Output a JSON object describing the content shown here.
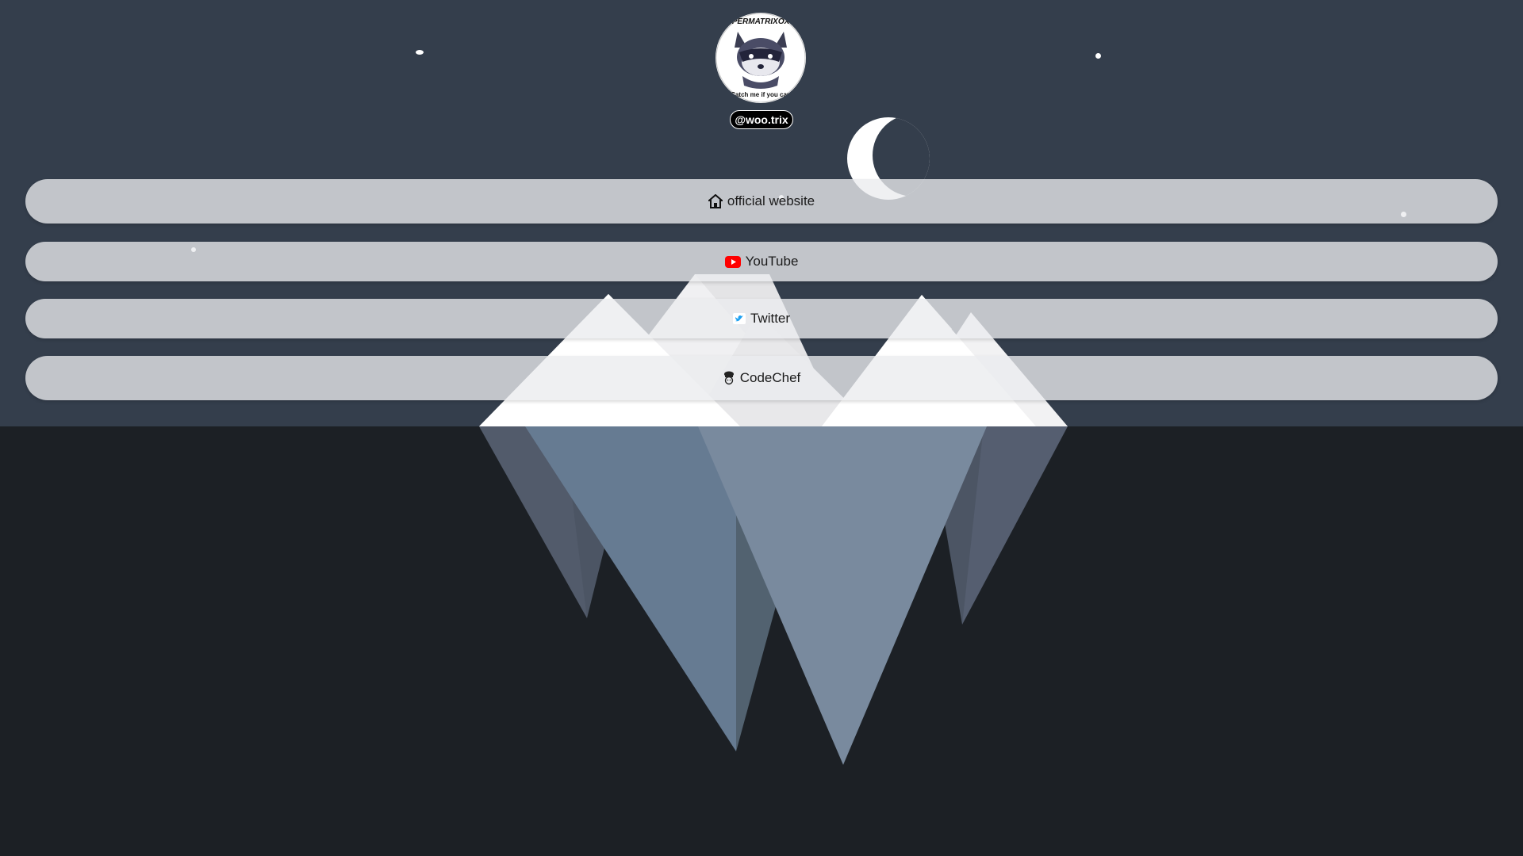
{
  "profile": {
    "avatar_top_text": "PERMATRIXOX",
    "avatar_bottom_text": "Catch me if you can",
    "handle": "@woo.trix"
  },
  "links": [
    {
      "label": "official website",
      "icon": "home-icon"
    },
    {
      "label": "YouTube",
      "icon": "youtube-icon"
    },
    {
      "label": "Twitter",
      "icon": "twitter-icon"
    },
    {
      "label": "CodeChef",
      "icon": "codechef-chef-icon"
    }
  ],
  "colors": {
    "sky": "#343e4c",
    "ground": "#1c2025",
    "link_background": "#ebecee",
    "youtube_red": "#ff0000",
    "twitter_blue": "#1da1f2"
  }
}
